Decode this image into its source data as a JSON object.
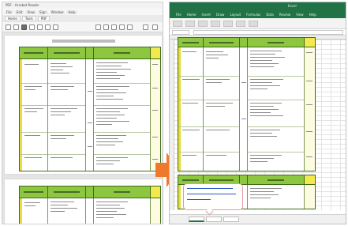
{
  "pdf_viewer": {
    "title": "PDF - Acrobat Reader",
    "menu": [
      "File",
      "Edit",
      "View",
      "Sign",
      "Window",
      "Help"
    ],
    "tabs": [
      "Home",
      "Tools",
      "PDF"
    ]
  },
  "excel": {
    "title": "Excel",
    "ribbon_tabs": [
      "File",
      "Home",
      "Insert",
      "Draw",
      "Layout",
      "Formulas",
      "Data",
      "Review",
      "View",
      "Help"
    ],
    "accent": "#217346"
  },
  "arrow": {
    "color": "#f0782b"
  },
  "note": {
    "text": ""
  }
}
